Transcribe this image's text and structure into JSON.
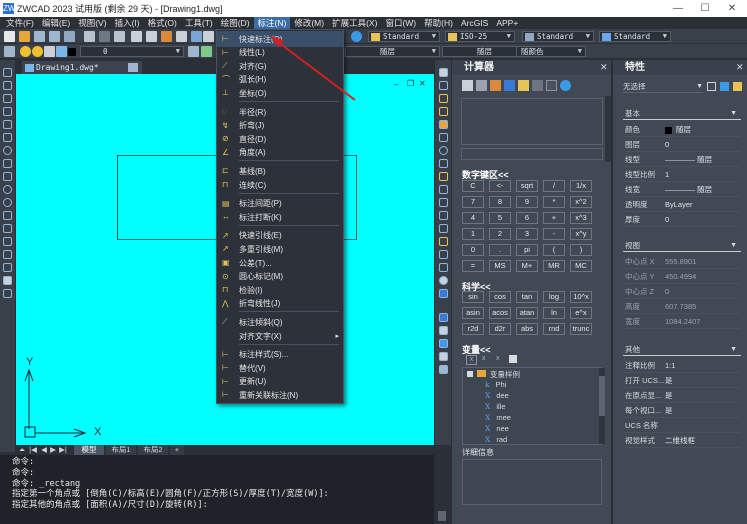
{
  "window": {
    "title": "ZWCAD 2023 试用版 (剩余 29 天) - [Drawing1.dwg]",
    "logo": "ZW",
    "controls": {
      "minimize": "—",
      "maximize": "☐",
      "close": "✕"
    }
  },
  "menubar": {
    "items": [
      {
        "label": "文件(F)"
      },
      {
        "label": "编辑(E)"
      },
      {
        "label": "视图(V)"
      },
      {
        "label": "插入(I)"
      },
      {
        "label": "格式(O)"
      },
      {
        "label": "工具(T)"
      },
      {
        "label": "绘图(D)"
      },
      {
        "label": "标注(N)",
        "active": true
      },
      {
        "label": "修改(M)"
      },
      {
        "label": "扩展工具(X)"
      },
      {
        "label": "窗口(W)"
      },
      {
        "label": "帮助(H)"
      },
      {
        "label": "ArcGIS"
      },
      {
        "label": "APP+"
      }
    ]
  },
  "toolbar": {
    "text_style": "Standard",
    "dim_style": "ISO-25",
    "table_style": "Standard",
    "multileader_style": "Standard",
    "layer": "0",
    "linetype": "随层",
    "lineweight": "随层",
    "color": "随颜色"
  },
  "document": {
    "tab_name": "Drawing1.dwg",
    "tab_modified_marker": "*",
    "close_icon": "✕",
    "viewport_controls": {
      "minimize": "–",
      "restore": "❐",
      "close": "✕"
    }
  },
  "ucs": {
    "x_label": "X",
    "y_label": "Y"
  },
  "layout_tabs": {
    "nav": [
      "⏶",
      "|◀",
      "◀",
      "▶",
      "▶|"
    ],
    "tabs": [
      {
        "label": "模型",
        "active": true
      },
      {
        "label": "布局1"
      },
      {
        "label": "布局2"
      },
      {
        "label": "+"
      }
    ]
  },
  "command": {
    "lines": [
      "命令:",
      "命令:",
      "命令: _rectang",
      "指定第一个角点或 [倒角(C)/标高(E)/圆角(F)/正方形(S)/厚度(T)/宽度(W)]:",
      "指定其他的角点或 [面积(A)/尺寸(D)/旋转(R)]:"
    ]
  },
  "dim_menu": {
    "items": [
      {
        "label": "快速标注(Q)",
        "icon": "quick-dimension-icon",
        "glyph": "⊢",
        "highlighted": true
      },
      {
        "label": "线性(L)",
        "icon": "linear-dimension-icon",
        "glyph": "⊢"
      },
      {
        "label": "对齐(G)",
        "icon": "aligned-dimension-icon",
        "glyph": "⟋"
      },
      {
        "label": "弧长(H)",
        "icon": "arc-length-icon",
        "glyph": "⌒"
      },
      {
        "label": "坐标(O)",
        "icon": "ordinate-icon",
        "glyph": "⊥"
      },
      {
        "label": "半径(R)",
        "icon": "radius-icon",
        "glyph": "◌"
      },
      {
        "label": "折弯(J)",
        "icon": "jogged-icon",
        "glyph": "↯"
      },
      {
        "label": "直径(D)",
        "icon": "diameter-icon",
        "glyph": "⊘"
      },
      {
        "label": "角度(A)",
        "icon": "angular-icon",
        "glyph": "∠"
      },
      {
        "label": "基线(B)",
        "icon": "baseline-icon",
        "glyph": "⊏"
      },
      {
        "label": "连续(C)",
        "icon": "continue-icon",
        "glyph": "⊓"
      },
      {
        "label": "标注间距(P)",
        "icon": "dim-space-icon",
        "glyph": "▤"
      },
      {
        "label": "标注打断(K)",
        "icon": "dim-break-icon",
        "glyph": "↔"
      },
      {
        "label": "快速引线(E)",
        "icon": "quick-leader-icon",
        "glyph": "↗"
      },
      {
        "label": "多重引线(M)",
        "icon": "multileader-icon",
        "glyph": "↗"
      },
      {
        "label": "公差(T)...",
        "icon": "tolerance-icon",
        "glyph": "▣"
      },
      {
        "label": "圆心标记(M)",
        "icon": "center-mark-icon",
        "glyph": "⊙"
      },
      {
        "label": "检验(I)",
        "icon": "inspection-icon",
        "glyph": "⊓"
      },
      {
        "label": "折弯线性(J)",
        "icon": "jogged-linear-icon",
        "glyph": "⋀"
      },
      {
        "label": "标注倾斜(Q)",
        "icon": "oblique-icon",
        "glyph": "⟋"
      },
      {
        "label": "对齐文字(X)",
        "icon": "",
        "glyph": "",
        "submenu": true
      },
      {
        "label": "标注样式(S)...",
        "icon": "dim-style-icon",
        "glyph": "⊢"
      },
      {
        "label": "替代(V)",
        "icon": "override-icon",
        "glyph": "⊢"
      },
      {
        "label": "更新(U)",
        "icon": "update-icon",
        "glyph": "⊢"
      },
      {
        "label": "重新关联标注(N)",
        "icon": "reassociate-icon",
        "glyph": "⊢"
      }
    ],
    "submenu_arrow": "▸"
  },
  "calculator": {
    "title": "计算器",
    "close": "✕",
    "numpad_title": "数字键区<<",
    "numpad": [
      [
        "C",
        "<-",
        "sqrt",
        "/",
        "1/x"
      ],
      [
        "7",
        "8",
        "9",
        "*",
        "x^2"
      ],
      [
        "4",
        "5",
        "6",
        "+",
        "x^3"
      ],
      [
        "1",
        "2",
        "3",
        "-",
        "x^y"
      ],
      [
        "0",
        ".",
        "pi",
        "(",
        ")"
      ],
      [
        "=",
        "MS",
        "M+",
        "MR",
        "MC"
      ]
    ],
    "sci_title": "科学<<",
    "sci": [
      [
        "sin",
        "cos",
        "tan",
        "log",
        "10^x"
      ],
      [
        "asin",
        "acos",
        "atan",
        "ln",
        "e^x"
      ],
      [
        "r2d",
        "d2r",
        "abs",
        "rnd",
        "trunc"
      ]
    ],
    "var_title": "变量<<",
    "var_tree": {
      "folder": "变量样例",
      "items": [
        {
          "type": "k",
          "name": "Phi"
        },
        {
          "type": "X",
          "name": "dee"
        },
        {
          "type": "X",
          "name": "ille"
        },
        {
          "type": "X",
          "name": "mee"
        },
        {
          "type": "X",
          "name": "nee"
        },
        {
          "type": "X",
          "name": "rad"
        }
      ]
    },
    "details_title": "详细信息"
  },
  "properties": {
    "title": "特性",
    "close": "✕",
    "selection": "无选择",
    "sections": [
      {
        "name": "基本",
        "rows": [
          {
            "key": "颜色",
            "value": "随层",
            "swatch": "#000000"
          },
          {
            "key": "图层",
            "value": "0"
          },
          {
            "key": "线型",
            "value": "———— 随层"
          },
          {
            "key": "线型比例",
            "value": "1"
          },
          {
            "key": "线宽",
            "value": "———— 随层"
          },
          {
            "key": "透明度",
            "value": "ByLayer"
          },
          {
            "key": "厚度",
            "value": "0"
          }
        ]
      },
      {
        "name": "视图",
        "rows": [
          {
            "key": "中心点 X",
            "value": "555.8901",
            "dim": true
          },
          {
            "key": "中心点 Y",
            "value": "450.4994",
            "dim": true
          },
          {
            "key": "中心点 Z",
            "value": "0",
            "dim": true
          },
          {
            "key": "高度",
            "value": "607.7385",
            "dim": true
          },
          {
            "key": "宽度",
            "value": "1084.2407",
            "dim": true
          }
        ]
      },
      {
        "name": "其他",
        "rows": [
          {
            "key": "注释比例",
            "value": "1:1"
          },
          {
            "key": "打开 UCS...",
            "value": "是"
          },
          {
            "key": "在原点显...",
            "value": "是"
          },
          {
            "key": "每个视口...",
            "value": "是"
          },
          {
            "key": "UCS 名称",
            "value": ""
          },
          {
            "key": "视觉样式",
            "value": "二维线框"
          }
        ]
      }
    ]
  }
}
